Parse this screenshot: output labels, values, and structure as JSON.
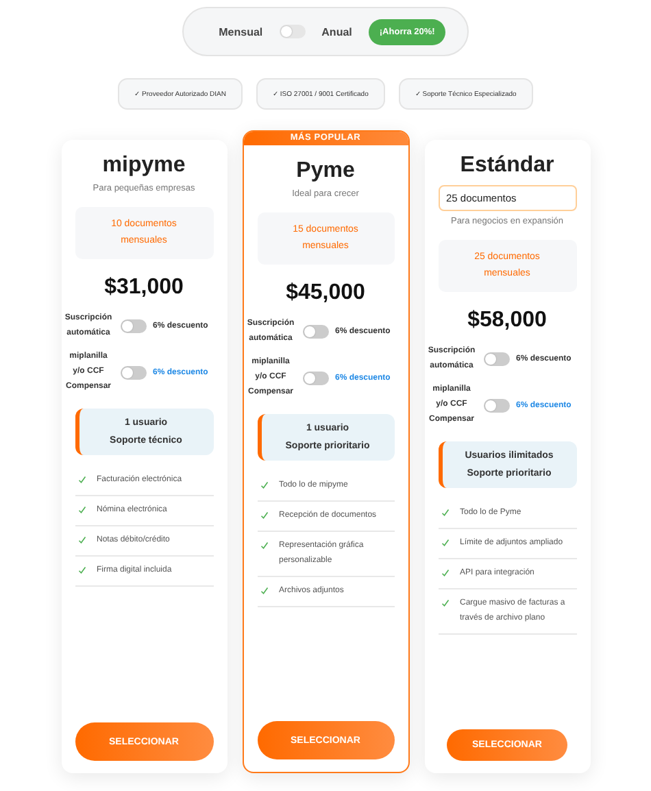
{
  "billing_toggle": {
    "monthly_label": "Mensual",
    "annual_label": "Anual",
    "on": false,
    "savings_badge": "¡Ahorra 20%!"
  },
  "trust_badges": [
    "✓ Proveedor Autorizado DIAN",
    "✓ ISO 27001 / 9001 Certificado",
    "✓ Soporte Técnico Especializado"
  ],
  "plans": [
    {
      "name": "mipyme",
      "featured": false,
      "subtitle": "Para pequeñas empresas",
      "documents": "10 documentos mensuales",
      "price": "$31,000",
      "toggles": [
        {
          "label": "Suscripción automática",
          "on": false,
          "discount": "6% descuento"
        },
        {
          "label": "miplanilla y/o CCF Compensar",
          "on": false,
          "discount": "6% descuento"
        }
      ],
      "support": [
        "1 usuario",
        "Soporte técnico"
      ],
      "features": [
        "Facturación electrónica",
        "Nómina electrónica",
        "Notas débito/crédito",
        "Firma digital incluida"
      ],
      "button": "SELECCIONAR"
    },
    {
      "name": "Pyme",
      "featured": true,
      "ribbon": "MÁS POPULAR",
      "subtitle": "Ideal para crecer",
      "documents": "15 documentos mensuales",
      "price": "$45,000",
      "toggles": [
        {
          "label": "Suscripción automática",
          "on": false,
          "discount": "6% descuento"
        },
        {
          "label": "miplanilla y/o CCF Compensar",
          "on": false,
          "discount": "6% descuento"
        }
      ],
      "support": [
        "1 usuario",
        "Soporte prioritario"
      ],
      "features": [
        "Todo lo de mipyme",
        "Recepción de documentos",
        "Representación gráfica personalizable",
        "Archivos adjuntos"
      ],
      "button": "SELECCIONAR"
    },
    {
      "name": "Estándar",
      "featured": false,
      "document_select": "25 documentos",
      "subtitle": "Para negocios en expansión",
      "documents": "25 documentos mensuales",
      "price": "$58,000",
      "toggles": [
        {
          "label": "Suscripción automática",
          "on": false,
          "discount": "6% descuento"
        },
        {
          "label": "miplanilla y/o CCF Compensar",
          "on": false,
          "discount": "6% descuento"
        }
      ],
      "support": [
        "Usuarios ilimitados",
        "Soporte prioritario"
      ],
      "features": [
        "Todo lo de Pyme",
        "Límite de adjuntos ampliado",
        "API para integración",
        "Cargue masivo de facturas a través de archivo plano"
      ],
      "button": "SELECCIONAR"
    }
  ]
}
